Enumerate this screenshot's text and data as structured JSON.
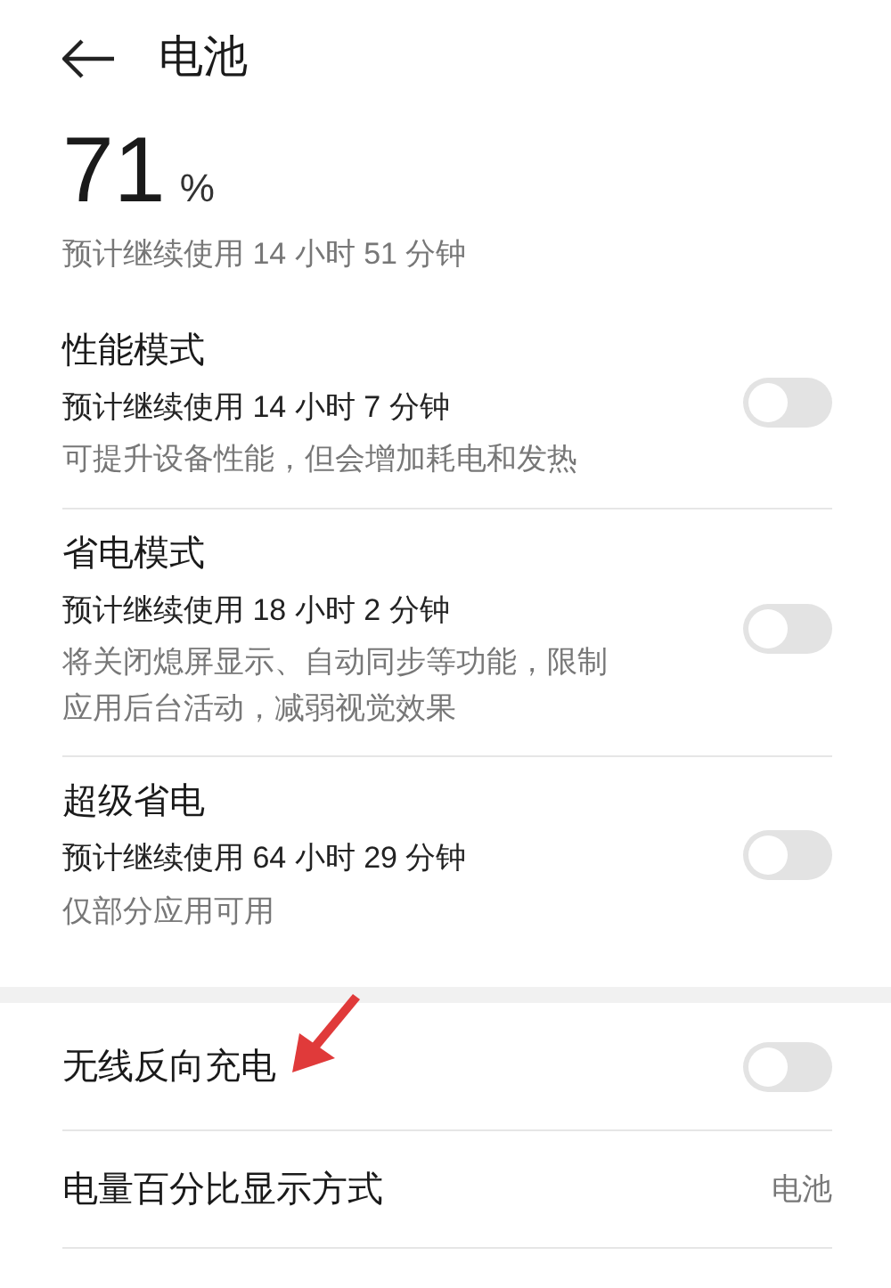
{
  "header": {
    "title": "电池"
  },
  "battery": {
    "percent": "71",
    "unit": "%",
    "estimate": "预计继续使用 14 小时 51 分钟"
  },
  "modes": [
    {
      "title": "性能模式",
      "estimate": "预计继续使用 14 小时 7 分钟",
      "description": "可提升设备性能，但会增加耗电和发热",
      "on": false
    },
    {
      "title": "省电模式",
      "estimate": "预计继续使用 18 小时 2 分钟",
      "description": "将关闭熄屏显示、自动同步等功能，限制应用后台活动，减弱视觉效果",
      "on": false
    },
    {
      "title": "超级省电",
      "estimate": "预计继续使用 64 小时 29 分钟",
      "description": "仅部分应用可用",
      "on": false
    }
  ],
  "other_settings": [
    {
      "kind": "toggle",
      "label": "无线反向充电",
      "on": false
    },
    {
      "kind": "value",
      "label": "电量百分比显示方式",
      "value": "电池"
    }
  ]
}
